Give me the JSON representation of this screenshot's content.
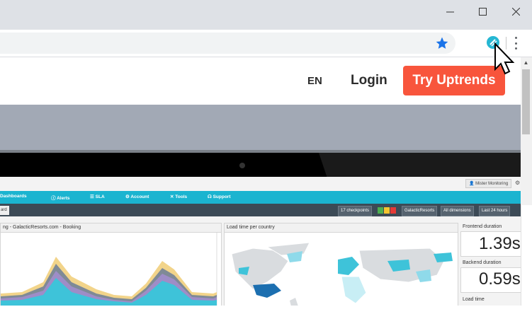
{
  "browser": {
    "window_controls": {
      "minimize": "minimize",
      "maximize": "maximize",
      "close": "close"
    }
  },
  "site": {
    "language": "EN",
    "login": "Login",
    "cta": "Try Uptrends",
    "brand_color": "#f8553c"
  },
  "dashboard": {
    "user": "Mister Monitoring",
    "menu": [
      "Dashboards",
      "Alerts",
      "SLA",
      "Account",
      "Tools",
      "Support"
    ],
    "tab_label": "ard",
    "filters": [
      "17 checkpoints",
      "GalacticResorts",
      "All dimensions",
      "Last 24 hours"
    ],
    "status_colors": [
      "#4caf50",
      "#f4c430",
      "#e53935"
    ],
    "chart_title": "ng - GalacticResorts.com - Booking",
    "map_title": "Load time per country",
    "metrics": [
      {
        "label": "Frontend duration",
        "value": "1.39s"
      },
      {
        "label": "Backend duration",
        "value": "0.59s"
      },
      {
        "label": "Load time",
        "value": ""
      }
    ]
  }
}
